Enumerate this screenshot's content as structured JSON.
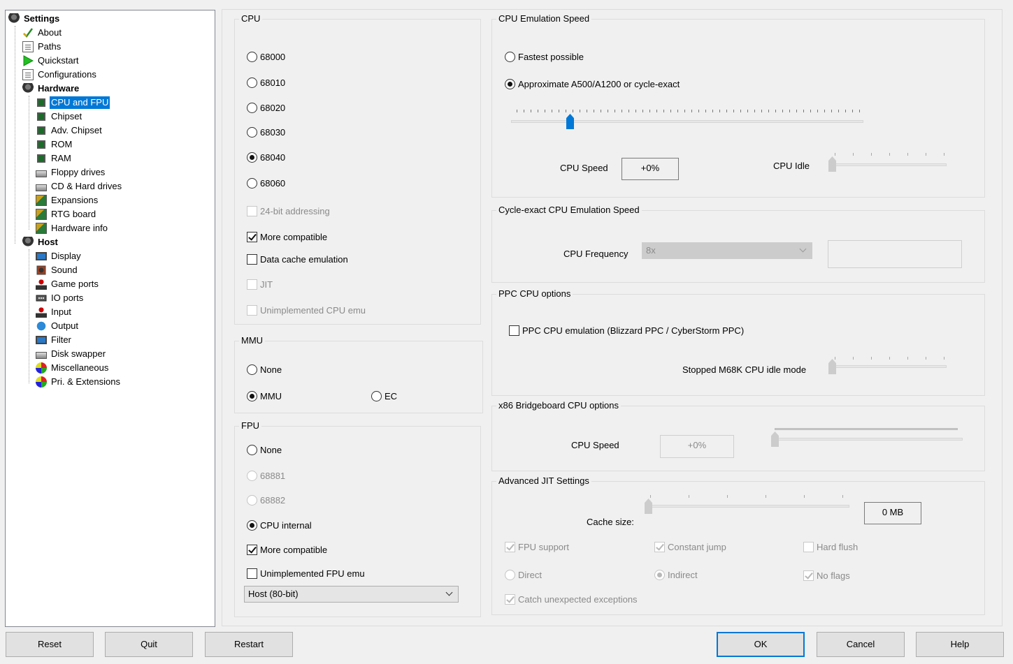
{
  "tree": {
    "root": "Settings",
    "items": [
      {
        "label": "About",
        "icon": "checkmark-icon"
      },
      {
        "label": "Paths",
        "icon": "document-icon"
      },
      {
        "label": "Quickstart",
        "icon": "play-icon"
      },
      {
        "label": "Configurations",
        "icon": "document-icon"
      }
    ],
    "hardware": {
      "label": "Hardware",
      "items": [
        {
          "label": "CPU and FPU",
          "icon": "chip-icon"
        },
        {
          "label": "Chipset",
          "icon": "chip-icon"
        },
        {
          "label": "Adv. Chipset",
          "icon": "chip-icon"
        },
        {
          "label": "ROM",
          "icon": "chip-icon"
        },
        {
          "label": "RAM",
          "icon": "chip-icon"
        },
        {
          "label": "Floppy drives",
          "icon": "drive-icon"
        },
        {
          "label": "CD & Hard drives",
          "icon": "drive-icon"
        },
        {
          "label": "Expansions",
          "icon": "card-icon"
        },
        {
          "label": "RTG board",
          "icon": "card-icon"
        },
        {
          "label": "Hardware info",
          "icon": "card-icon"
        }
      ]
    },
    "host": {
      "label": "Host",
      "items": [
        {
          "label": "Display",
          "icon": "monitor-icon"
        },
        {
          "label": "Sound",
          "icon": "speaker-icon"
        },
        {
          "label": "Game ports",
          "icon": "joystick-icon"
        },
        {
          "label": "IO ports",
          "icon": "port-icon"
        },
        {
          "label": "Input",
          "icon": "joystick-icon"
        },
        {
          "label": "Output",
          "icon": "globe-icon"
        },
        {
          "label": "Filter",
          "icon": "monitor-icon"
        },
        {
          "label": "Disk swapper",
          "icon": "drive-icon"
        },
        {
          "label": "Miscellaneous",
          "icon": "colors-icon"
        },
        {
          "label": "Pri. & Extensions",
          "icon": "colors-icon"
        }
      ]
    }
  },
  "cpu": {
    "title": "CPU",
    "options": [
      "68000",
      "68010",
      "68020",
      "68030",
      "68040",
      "68060"
    ],
    "selected": "68040",
    "addr24": "24-bit addressing",
    "more_compatible": "More compatible",
    "data_cache": "Data cache emulation",
    "jit": "JIT",
    "unimplemented": "Unimplemented CPU emu"
  },
  "mmu": {
    "title": "MMU",
    "none": "None",
    "mmu": "MMU",
    "ec": "EC"
  },
  "fpu": {
    "title": "FPU",
    "none": "None",
    "f68881": "68881",
    "f68882": "68882",
    "internal": "CPU internal",
    "more_compatible": "More compatible",
    "unimplemented": "Unimplemented FPU emu",
    "mode_value": "Host (80-bit)"
  },
  "speed": {
    "title": "CPU Emulation Speed",
    "fastest": "Fastest possible",
    "approx": "Approximate A500/A1200 or cycle-exact",
    "cpu_speed_label": "CPU Speed",
    "cpu_speed_value": "+0%",
    "cpu_idle_label": "CPU Idle",
    "speed_slider_fraction": 0.16,
    "idle_slider_fraction": 0.0
  },
  "cycle": {
    "title": "Cycle-exact CPU Emulation Speed",
    "freq_label": "CPU Frequency",
    "freq_value": "8x"
  },
  "ppc": {
    "title": "PPC CPU options",
    "emulation": "PPC CPU emulation (Blizzard PPC / CyberStorm PPC)",
    "idle_label": "Stopped M68K CPU idle mode"
  },
  "x86": {
    "title": "x86 Bridgeboard CPU options",
    "speed_label": "CPU Speed",
    "speed_value": "+0%"
  },
  "jit": {
    "title": "Advanced JIT Settings",
    "cache_label": "Cache size:",
    "cache_value": "0 MB",
    "fpu_support": "FPU support",
    "constant_jump": "Constant jump",
    "hard_flush": "Hard flush",
    "direct": "Direct",
    "indirect": "Indirect",
    "no_flags": "No flags",
    "catch_exceptions": "Catch unexpected exceptions"
  },
  "buttons": {
    "reset": "Reset",
    "quit": "Quit",
    "restart": "Restart",
    "ok": "OK",
    "cancel": "Cancel",
    "help": "Help"
  },
  "colors": {
    "selection": "#0078d7",
    "slider_thumb": "#0078d7"
  }
}
